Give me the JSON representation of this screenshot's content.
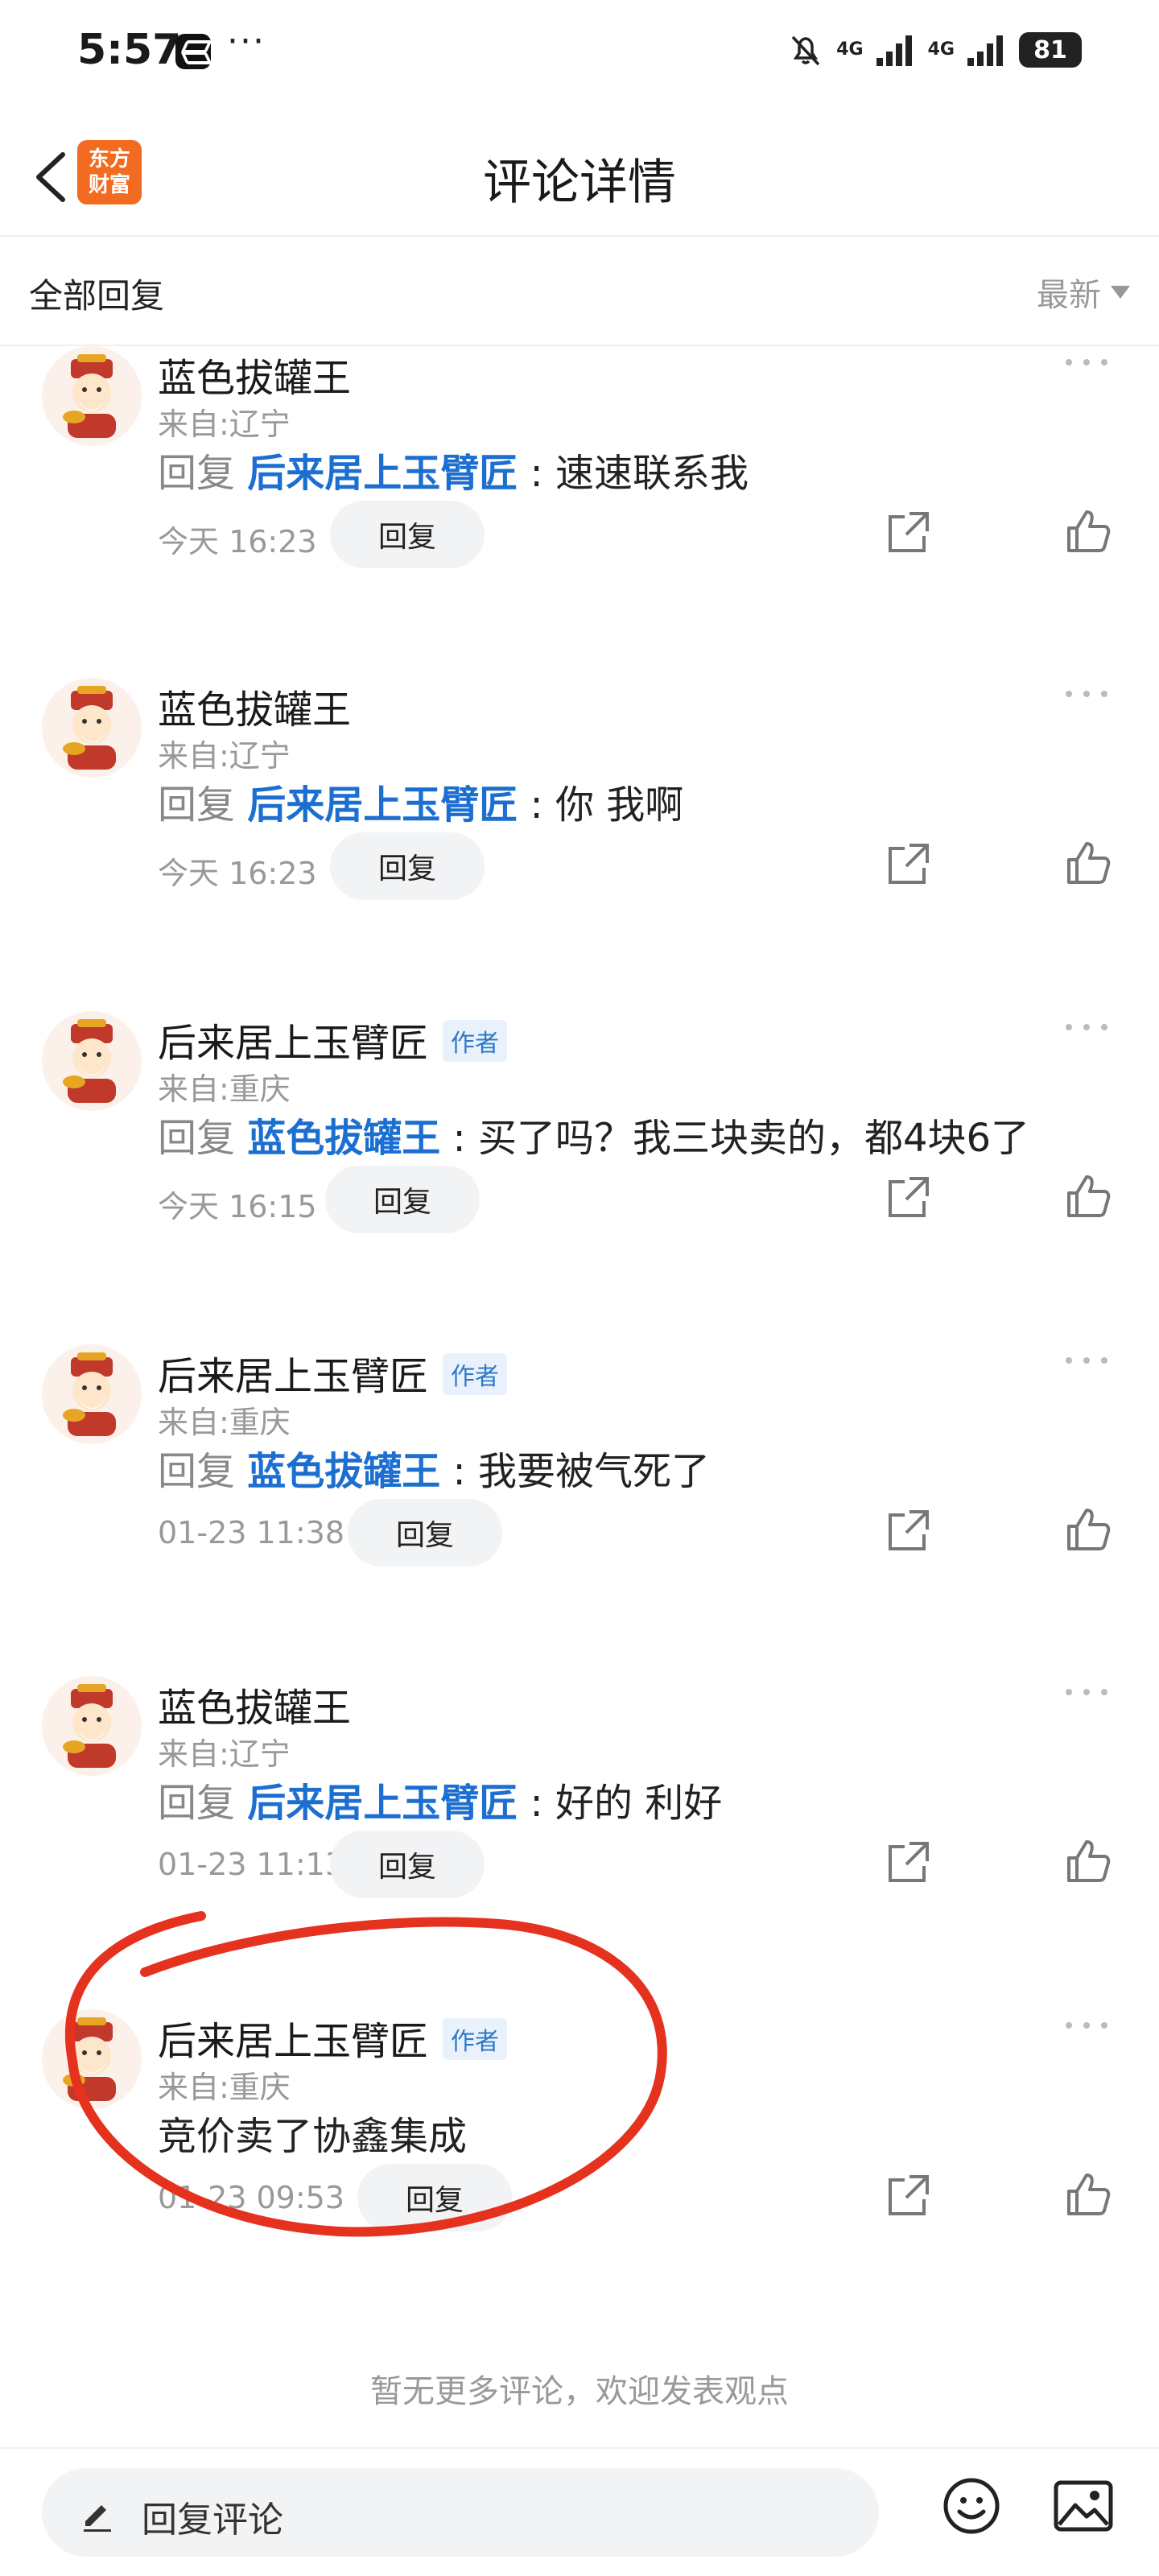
{
  "status_bar": {
    "time": "5:57",
    "dots": "···",
    "signal1": "4G",
    "signal2": "4G",
    "battery": "81"
  },
  "header": {
    "logo_line1": "东方",
    "logo_line2": "财富",
    "title": "评论详情"
  },
  "sub_header": {
    "all_replies": "全部回复",
    "sort": "最新"
  },
  "comments": [
    {
      "name": "蓝色拔罐王",
      "location": "来自:辽宁",
      "reply_prefix": "回复 ",
      "reply_target": "后来居上玉臂匠",
      "text": " : 速速联系我",
      "time": "今天 16:23",
      "reply_btn": "回复"
    },
    {
      "name": "蓝色拔罐王",
      "location": "来自:辽宁",
      "reply_prefix": "回复 ",
      "reply_target": "后来居上玉臂匠",
      "text": " : 你 我啊",
      "time": "今天 16:23",
      "reply_btn": "回复"
    },
    {
      "name": "后来居上玉臂匠",
      "badge": "作者",
      "location": "来自:重庆",
      "reply_prefix": "回复 ",
      "reply_target": "蓝色拔罐王",
      "text": " : 买了吗？我三块卖的，都4块6了",
      "time": "今天 16:15",
      "reply_btn": "回复"
    },
    {
      "name": "后来居上玉臂匠",
      "badge": "作者",
      "location": "来自:重庆",
      "reply_prefix": "回复 ",
      "reply_target": "蓝色拔罐王",
      "text": " : 我要被气死了",
      "time": "01-23 11:38",
      "reply_btn": "回复"
    },
    {
      "name": "蓝色拔罐王",
      "location": "来自:辽宁",
      "reply_prefix": "回复 ",
      "reply_target": "后来居上玉臂匠",
      "text": " : 好的 利好",
      "time": "01-23 11:13",
      "reply_btn": "回复"
    },
    {
      "name": "后来居上玉臂匠",
      "badge": "作者",
      "location": "来自:重庆",
      "text": "竞价卖了协鑫集成",
      "time": "01-23 09:53",
      "reply_btn": "回复"
    }
  ],
  "footer": {
    "no_more": "暂无更多评论，欢迎发表观点",
    "reply_placeholder": "回复评论"
  },
  "colors": {
    "accent_blue": "#1c6fd1",
    "brand_orange": "#f26b21",
    "annotation_red": "#e5321f"
  }
}
